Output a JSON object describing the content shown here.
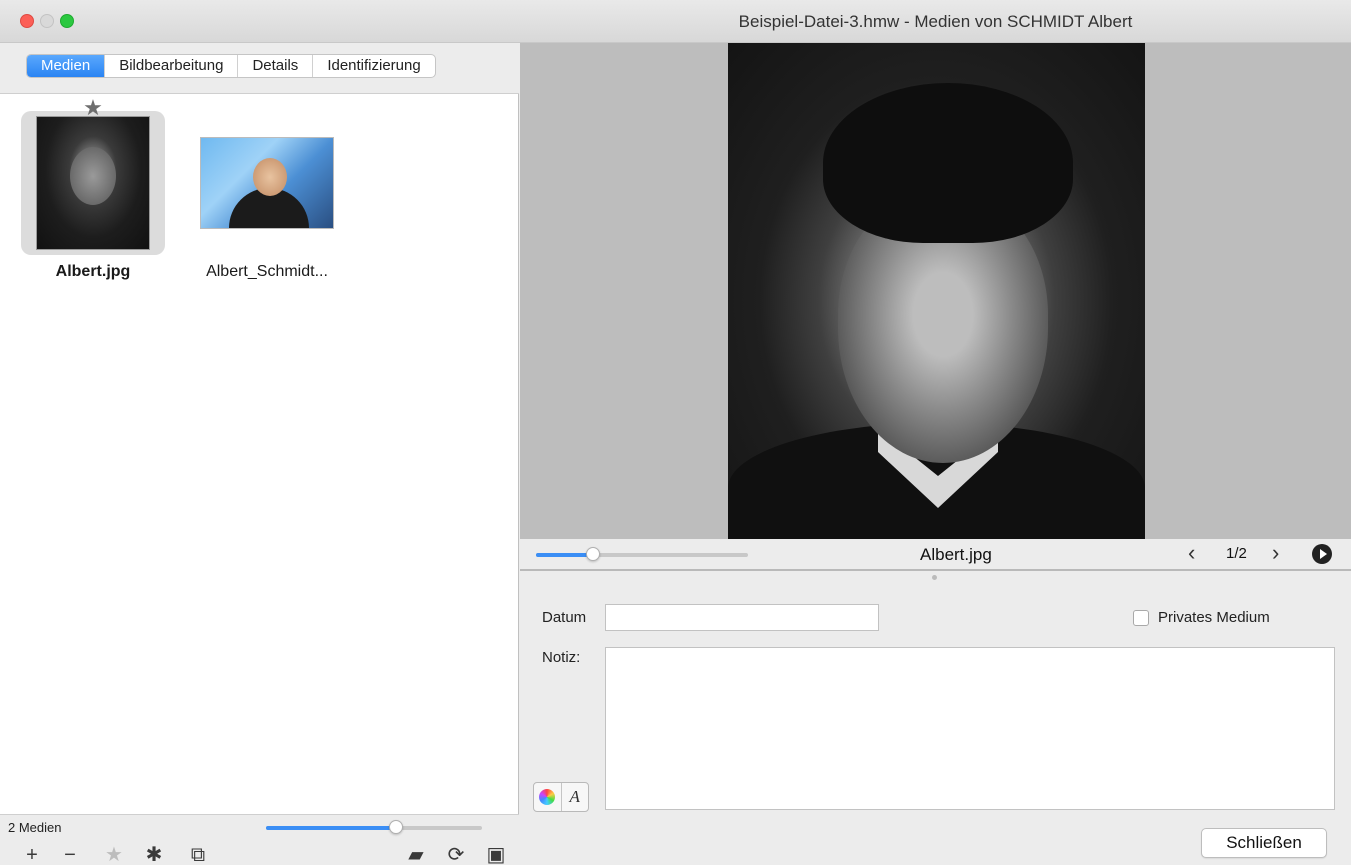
{
  "window": {
    "title": "Beispiel-Datei-3.hmw - Medien von SCHMIDT Albert"
  },
  "tabs": [
    {
      "label": "Medien",
      "active": true
    },
    {
      "label": "Bildbearbeitung",
      "active": false
    },
    {
      "label": "Details",
      "active": false
    },
    {
      "label": "Identifizierung",
      "active": false
    }
  ],
  "media": {
    "items": [
      {
        "label": "Albert.jpg",
        "selected": true,
        "starred": true
      },
      {
        "label": "Albert_Schmidt...",
        "selected": false,
        "starred": false
      }
    ],
    "count_label": "2 Medien",
    "thumbnail_size_percent": 60
  },
  "toolbar": {
    "icons": [
      "plus-icon",
      "minus-icon",
      "star-icon",
      "gear-icon",
      "gallery-icon",
      "folder-icon",
      "refresh-icon",
      "save-icon"
    ],
    "glyphs": {
      "plus": "+",
      "minus": "−",
      "star": "★",
      "gear": "✱",
      "gallery": "⧉",
      "folder": "▰",
      "refresh": "⟳",
      "save": "▣"
    }
  },
  "viewer": {
    "file_name": "Albert.jpg",
    "page_indicator": "1/2",
    "prev_glyph": "‹",
    "next_glyph": "›",
    "zoom_percent": 27
  },
  "form": {
    "datum_label": "Datum",
    "datum_value": "",
    "private_label": "Privates Medium",
    "private_checked": false,
    "notiz_label": "Notiz:",
    "notiz_value": "",
    "close_label": "Schließen",
    "font_glyph": "A"
  },
  "colors": {
    "accent": "#2a84f3",
    "close": "#fc5f57",
    "minimize": "#d9d9d9",
    "zoom": "#2bc840"
  }
}
